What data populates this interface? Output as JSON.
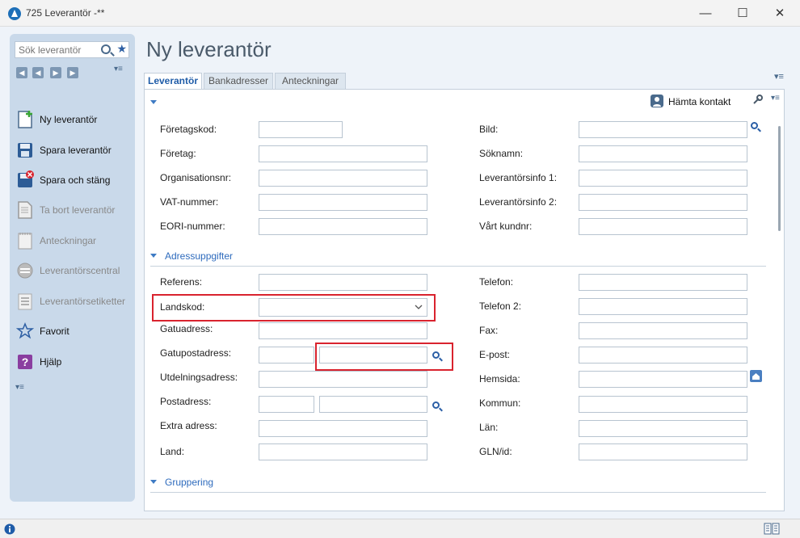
{
  "window": {
    "title": "725 Leverantör -**",
    "minimize": "—",
    "maximize": "☐",
    "close": "✕"
  },
  "sidebar": {
    "search_placeholder": "Sök leverantör",
    "items": [
      {
        "label": "Ny leverantör",
        "enabled": true
      },
      {
        "label": "Spara leverantör",
        "enabled": true
      },
      {
        "label": "Spara och stäng",
        "enabled": true
      },
      {
        "label": "Ta bort leverantör",
        "enabled": false
      },
      {
        "label": "Anteckningar",
        "enabled": false
      },
      {
        "label": "Leverantörscentral",
        "enabled": false
      },
      {
        "label": "Leverantörsetiketter",
        "enabled": false
      },
      {
        "label": "Favorit",
        "enabled": true
      },
      {
        "label": "Hjälp",
        "enabled": true
      }
    ]
  },
  "page": {
    "title": "Ny leverantör"
  },
  "tabs": [
    {
      "label": "Leverantör",
      "active": true
    },
    {
      "label": "Bankadresser",
      "active": false
    },
    {
      "label": "Anteckningar",
      "active": false
    }
  ],
  "toolbar": {
    "fetch_contact": "Hämta kontakt"
  },
  "form": {
    "top_left": [
      {
        "label": "Företagskod:",
        "value": ""
      },
      {
        "label": "Företag:",
        "value": ""
      },
      {
        "label": "Organisationsnr:",
        "value": ""
      },
      {
        "label": "VAT-nummer:",
        "value": ""
      },
      {
        "label": "EORI-nummer:",
        "value": ""
      }
    ],
    "top_right": [
      {
        "label": "Bild:",
        "value": ""
      },
      {
        "label": "Söknamn:",
        "value": ""
      },
      {
        "label": "Leverantörsinfo 1:",
        "value": ""
      },
      {
        "label": "Leverantörsinfo 2:",
        "value": ""
      },
      {
        "label": "Vårt kundnr:",
        "value": ""
      }
    ],
    "section_address": "Adressuppgifter",
    "addr_left": [
      {
        "label": "Referens:",
        "value": ""
      },
      {
        "label": "Landskod:",
        "value": ""
      },
      {
        "label": "Gatuadress:",
        "value": ""
      },
      {
        "label": "Gatupostadress:",
        "value": ""
      },
      {
        "label": "Utdelningsadress:",
        "value": ""
      },
      {
        "label": "Postadress:",
        "value": ""
      },
      {
        "label": "Extra adress:",
        "value": ""
      },
      {
        "label": "Land:",
        "value": ""
      }
    ],
    "addr_right": [
      {
        "label": "Telefon:",
        "value": ""
      },
      {
        "label": "Telefon 2:",
        "value": ""
      },
      {
        "label": "Fax:",
        "value": ""
      },
      {
        "label": "E-post:",
        "value": ""
      },
      {
        "label": "Hemsida:",
        "value": ""
      },
      {
        "label": "Kommun:",
        "value": ""
      },
      {
        "label": "Län:",
        "value": ""
      },
      {
        "label": "GLN/id:",
        "value": ""
      }
    ],
    "section_grouping": "Gruppering"
  },
  "colors": {
    "highlight": "#d9232e",
    "accent": "#2e6bbd",
    "sidebar": "#c9d9ea"
  }
}
